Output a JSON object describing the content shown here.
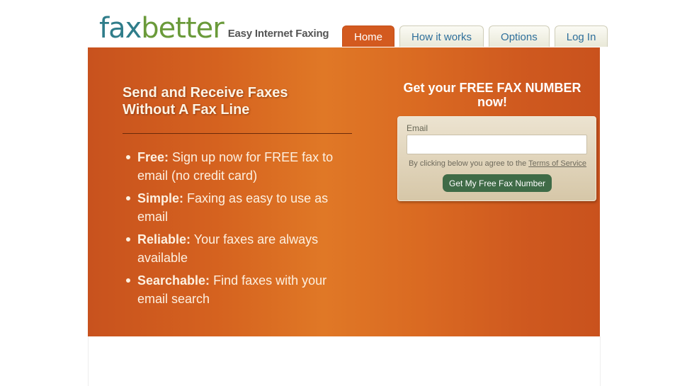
{
  "header": {
    "logo": {
      "part1": "fax",
      "part2": "better",
      "tagline": "Easy Internet Faxing"
    },
    "tabs": [
      {
        "label": "Home",
        "active": true
      },
      {
        "label": "How it works",
        "active": false
      },
      {
        "label": "Options",
        "active": false
      },
      {
        "label": "Log In",
        "active": false
      }
    ]
  },
  "hero": {
    "title": "Send and Receive Faxes Without A Fax Line",
    "features": [
      {
        "label": "Free:",
        "text": "Sign up now for FREE fax to email (no credit card)"
      },
      {
        "label": "Simple:",
        "text": "Faxing as easy to use as email"
      },
      {
        "label": "Reliable:",
        "text": "Your faxes are always available"
      },
      {
        "label": "Searchable:",
        "text": "Find faxes with your email search"
      }
    ]
  },
  "signup": {
    "title": "Get your FREE FAX NUMBER now!",
    "email_label": "Email",
    "email_value": "",
    "agree_prefix": "By clicking below you agree to the",
    "terms_link": "Terms of Service",
    "button_label": "Get My Free Fax Number"
  },
  "colors": {
    "brand_orange": "#d35a1f",
    "logo_teal": "#2f7d8a",
    "logo_green": "#6a9a3a",
    "button_green": "#3f6b47",
    "tab_text": "#2e6f9b"
  }
}
